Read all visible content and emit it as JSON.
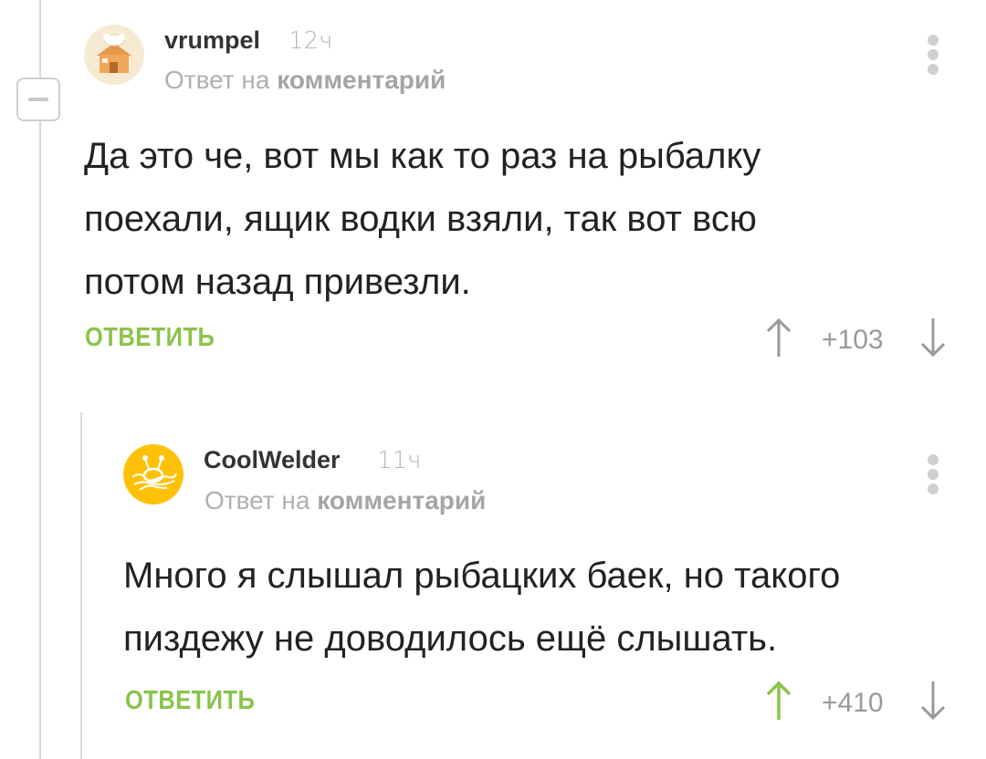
{
  "colors": {
    "accent": "#8bc34a",
    "text": "#222222",
    "muted": "#b0b0b0",
    "thread_line": "#d9d9d9"
  },
  "comments": [
    {
      "username": "vrumpel",
      "time": "12ч",
      "reply_prefix": "Ответ на",
      "reply_target": "комментарий",
      "text": "Да это че, вот мы как то раз на рыбалку\nпоехали, ящик водки взяли, так вот всю\nпотом назад привезли.",
      "reply_label": "ОТВЕТИТЬ",
      "score": "+103",
      "upvoted": false,
      "avatar_icon": "house-with-chef-hat-avatar"
    },
    {
      "username": "CoolWelder",
      "time": "11ч",
      "reply_prefix": "Ответ на",
      "reply_target": "комментарий",
      "text": "Много я слышал рыбацких баек, но такого\nпиздежу не доводилось ещё слышать.",
      "reply_label": "ОТВЕТИТЬ",
      "score": "+410",
      "upvoted": true,
      "avatar_icon": "flying-spaghetti-monster-avatar"
    }
  ]
}
